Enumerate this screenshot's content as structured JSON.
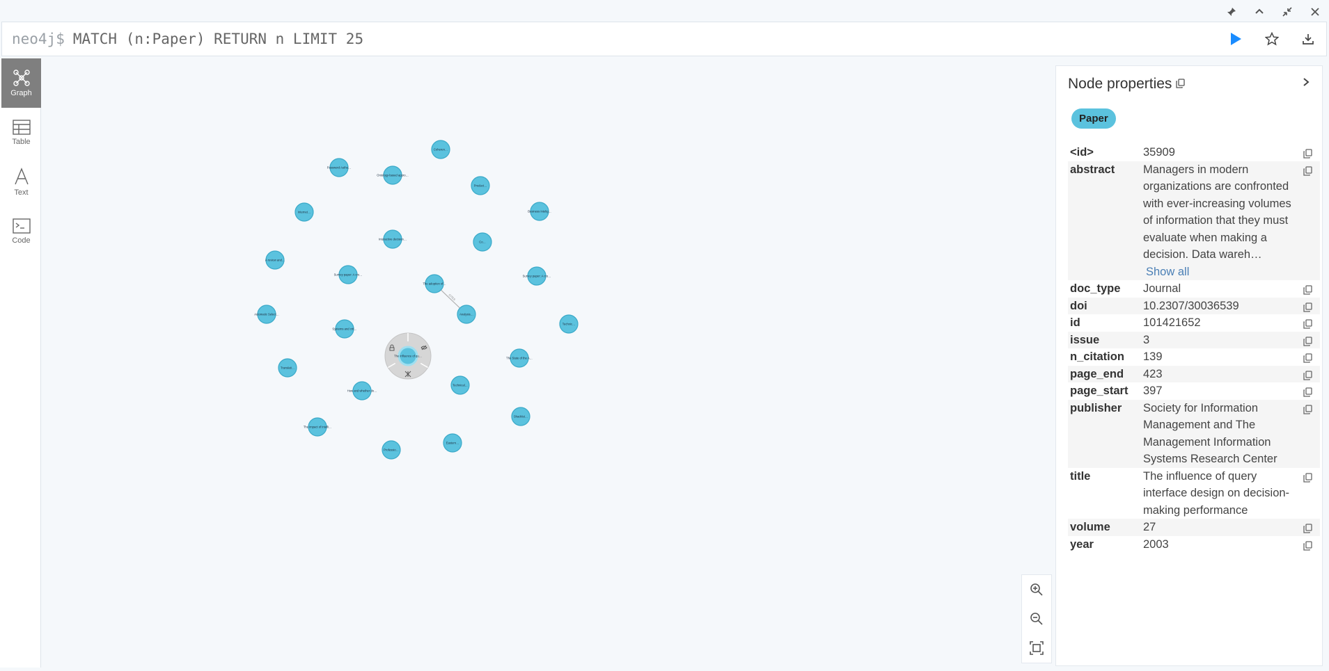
{
  "window": {
    "controls": [
      "pin-icon",
      "chevron-up-icon",
      "collapse-icon",
      "close-icon"
    ]
  },
  "editor": {
    "prompt": "neo4j$",
    "query": "MATCH (n:Paper) RETURN n LIMIT 25"
  },
  "sidebar": {
    "items": [
      {
        "label": "Graph",
        "icon": "graph-icon",
        "active": true
      },
      {
        "label": "Table",
        "icon": "table-icon",
        "active": false
      },
      {
        "label": "Text",
        "icon": "text-icon",
        "active": false
      },
      {
        "label": "Code",
        "icon": "code-icon",
        "active": false
      }
    ]
  },
  "graph": {
    "node_color": "#5bc2de",
    "nodes": [
      "Coheren…",
      "Password Authe…",
      "Ontology-based appro…",
      "Product…",
      "Business Intelig…",
      "Internet…",
      "Interactive decision…",
      "Co…",
      "A review and…",
      "Survey paper: A cro…",
      "The adoption of…",
      "Survey paper: A cro…",
      "Automatic Select…",
      "Systems and crit…",
      "Analysis…",
      "Technic…",
      "Translati…",
      "The influence of qu…",
      "The State of the A…",
      "How and whether do…",
      "Technical…",
      "The impact of intelli…",
      "Shacklet…",
      "Professio…",
      "Eastern…"
    ],
    "relationship": "CITES",
    "selected": "The influence of qu…"
  },
  "zoom": {
    "buttons": [
      "zoom-in-icon",
      "zoom-out-icon",
      "fit-icon"
    ]
  },
  "panel": {
    "title": "Node properties",
    "label": "Paper",
    "show_all": "Show all",
    "properties": [
      {
        "key": "<id>",
        "value": "35909"
      },
      {
        "key": "abstract",
        "value": "Managers in modern organizations are confronted with ever-increasing volumes of information that they must evaluate when making a decision. Data wareh…"
      },
      {
        "key": "doc_type",
        "value": "Journal"
      },
      {
        "key": "doi",
        "value": "10.2307/30036539"
      },
      {
        "key": "id",
        "value": "101421652"
      },
      {
        "key": "issue",
        "value": "3"
      },
      {
        "key": "n_citation",
        "value": "139"
      },
      {
        "key": "page_end",
        "value": "423"
      },
      {
        "key": "page_start",
        "value": "397"
      },
      {
        "key": "publisher",
        "value": "Society for Information Management and The Management Information Systems Research Center"
      },
      {
        "key": "title",
        "value": "The influence of query interface design on decision-making performance"
      },
      {
        "key": "volume",
        "value": "27"
      },
      {
        "key": "year",
        "value": "2003"
      }
    ]
  }
}
